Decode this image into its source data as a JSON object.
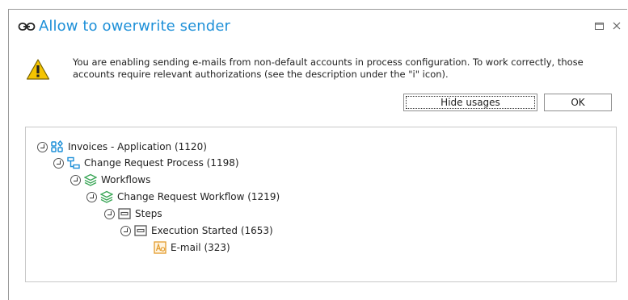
{
  "dialog": {
    "title": "Allow to owerwrite sender",
    "title_icon": "link-icon",
    "warning_icon": "warning-icon",
    "message": "You are enabling sending e-mails from non-default accounts in process configuration. To work correctly, those accounts require relevant authorizations (see the description under the \"i\" icon).",
    "buttons": {
      "hide_usages": "Hide usages",
      "ok": "OK"
    },
    "window_controls": [
      "maximize-icon",
      "close-icon"
    ]
  },
  "tree": {
    "nodes": [
      {
        "label": "Invoices - Application (1120)",
        "icon": "application-icon",
        "level": 0
      },
      {
        "label": "Change Request Process (1198)",
        "icon": "process-icon",
        "level": 1
      },
      {
        "label": "Workflows",
        "icon": "workflows-icon",
        "level": 2
      },
      {
        "label": "Change Request Workflow (1219)",
        "icon": "workflow-icon",
        "level": 3
      },
      {
        "label": "Steps",
        "icon": "steps-icon",
        "level": 4
      },
      {
        "label": "Execution Started (1653)",
        "icon": "step-icon",
        "level": 5
      },
      {
        "label": "E-mail (323)",
        "icon": "email-action-icon",
        "level": 6
      }
    ]
  },
  "colors": {
    "title": "#1e90d8",
    "warning": "#f5c400",
    "accent_blue": "#1e90d8",
    "accent_green": "#3aa657",
    "accent_orange": "#e39b2b"
  }
}
